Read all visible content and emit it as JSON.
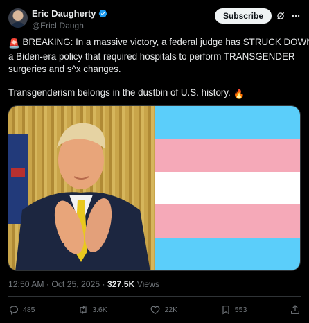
{
  "author": {
    "display_name": "Eric Daugherty",
    "handle": "@EricLDaugh",
    "verified": true
  },
  "header": {
    "subscribe_label": "Subscribe"
  },
  "tweet": {
    "lines": [
      "BREAKING: In a massive victory, a federal judge has STRUCK DOWN",
      "a Biden-era policy that required hospitals to perform TRANSGENDER",
      "surgeries and s^x changes.",
      "Transgenderism belongs in the dustbin of U.S. history."
    ],
    "emoji_start": "🚨",
    "emoji_end": "🔥"
  },
  "media": {
    "flag_colors": [
      "#5BCEFA",
      "#F5A9B8",
      "#FFFFFF",
      "#F5A9B8",
      "#5BCEFA"
    ]
  },
  "meta": {
    "time": "12:50 AM",
    "separator": "·",
    "date": "Oct 25, 2025",
    "views_count": "327.5K",
    "views_label": "Views"
  },
  "actions": {
    "replies": "485",
    "reposts": "3.6K",
    "likes": "22K",
    "bookmarks": "553"
  },
  "colors": {
    "background": "#000000",
    "text": "#e7e9ea",
    "muted": "#71767b",
    "verified": "#1d9bf0",
    "divider": "#2f3336"
  }
}
